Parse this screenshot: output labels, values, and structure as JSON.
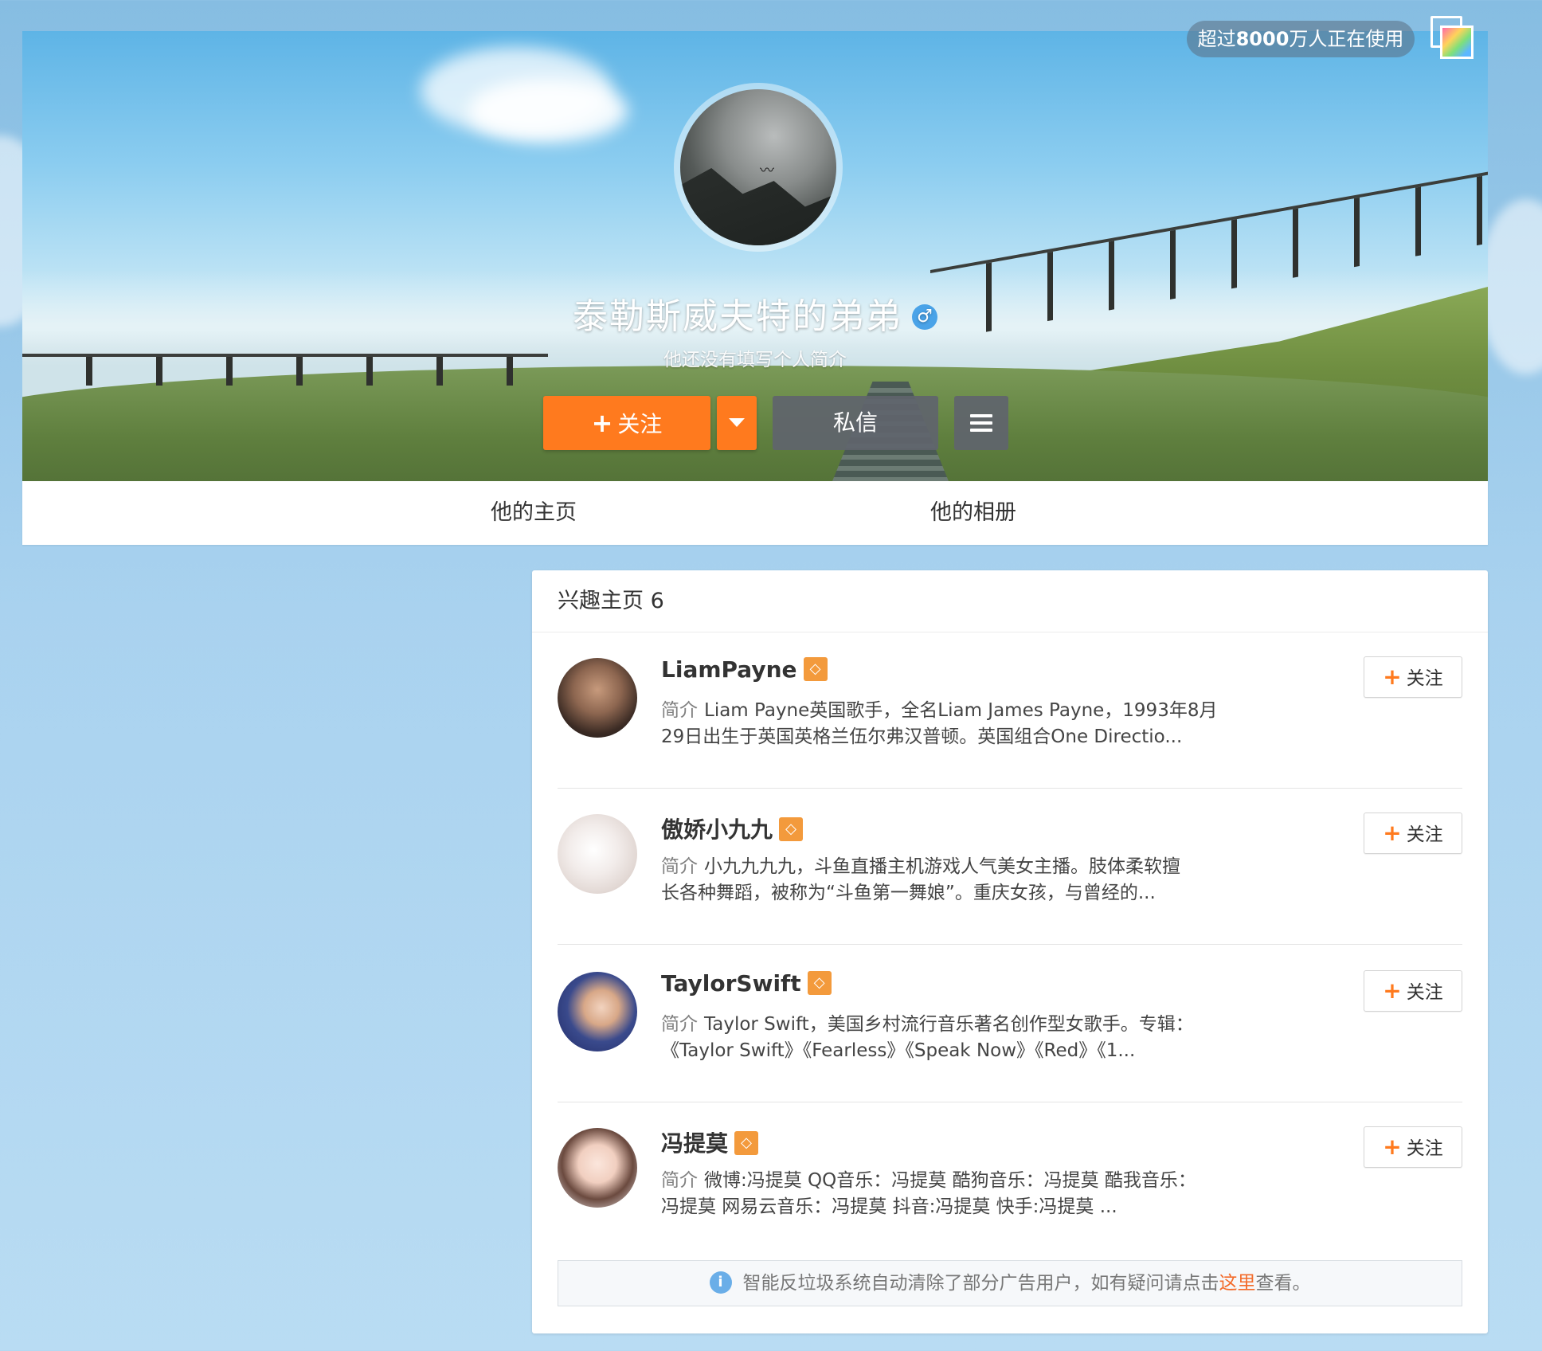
{
  "top_bar": {
    "usage_prefix": "超过",
    "usage_number": "8000",
    "usage_suffix": "万人正在使用",
    "skin_icon": "skin-palette-icon"
  },
  "profile": {
    "name": "泰勒斯威夫特的弟弟",
    "gender_symbol": "♂",
    "bio": "他还没有填写个人简介",
    "follow_label": "关注",
    "message_label": "私信"
  },
  "tabs": [
    {
      "label": "他的主页"
    },
    {
      "label": "他的相册"
    }
  ],
  "interest": {
    "title": "兴趣主页",
    "count": "6",
    "items": [
      {
        "name": "LiamPayne",
        "desc_label": "简介",
        "desc_line1": "Liam Payne英国歌手，全名Liam James Payne，1993年8月",
        "desc_line2": "29日出生于英国英格兰伍尔弗汉普顿。英国组合One Directio...",
        "follow_label": "关注"
      },
      {
        "name": "傲娇小九九",
        "desc_label": "简介",
        "desc_line1": "小九九九九，斗鱼直播主机游戏人气美女主播。肢体柔软擅",
        "desc_line2": "长各种舞蹈，被称为“斗鱼第一舞娘”。重庆女孩，与曾经的...",
        "follow_label": "关注"
      },
      {
        "name": "TaylorSwift",
        "desc_label": "简介",
        "desc_line1": "Taylor Swift，美国乡村流行音乐著名创作型女歌手。专辑：",
        "desc_line2": "《Taylor Swift》《Fearless》《Speak Now》《Red》《1...",
        "follow_label": "关注"
      },
      {
        "name": "冯提莫",
        "desc_label": "简介",
        "desc_line1": "微博:冯提莫 QQ音乐：冯提莫 酷狗音乐：冯提莫 酷我音乐：",
        "desc_line2": "冯提莫 网易云音乐：冯提莫 抖音:冯提莫 快手:冯提莫 ...",
        "follow_label": "关注"
      }
    ]
  },
  "notice": {
    "text_before": "智能反垃圾系统自动清除了部分广告用户，如有疑问请点击",
    "link_text": "这里",
    "text_after": "查看。"
  },
  "colors": {
    "accent_orange": "#ff7a1e",
    "badge_orange": "#f39a3c",
    "link_red": "#f36b2a",
    "gender_blue": "#4aa3e8"
  }
}
